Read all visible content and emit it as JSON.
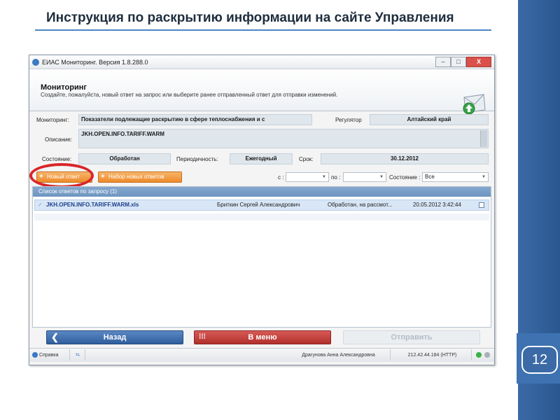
{
  "slide": {
    "title": "Инструкция по раскрытию информации на сайте Управления",
    "page_number": "12"
  },
  "window": {
    "title": "ЕИАС Мониторинг. Версия 1.8.288.0",
    "buttons": {
      "minimize": "–",
      "maximize": "□",
      "close": "X"
    }
  },
  "header": {
    "title": "Мониторинг",
    "subtitle": "Создайте, пожалуйста, новый ответ на запрос или выберите ранее отправленный ответ для отправки изменений."
  },
  "form": {
    "monitoring_label": "Мониторинг:",
    "monitoring_value": "Показатели подлежащие раскрытию в сфере теплоснабжения и с",
    "regulator_label": "Регулятор",
    "regulator_value": "Алтайский край",
    "description_label": "Описание:",
    "description_value": "JKH.OPEN.INFO.TARIFF.WARM",
    "state_label": "Состояние:",
    "state_value": "Обработан",
    "period_label": "Периодичность:",
    "period_value": "Ежегодный",
    "deadline_label": "Срок:",
    "deadline_value": "30.12.2012"
  },
  "toolbar": {
    "new_answer": "Новый ответ",
    "new_answers_set": "Набор новых ответов",
    "from_label": "с :",
    "to_label": "по :",
    "state_filter_label": "Состояние :",
    "state_filter_value": "Все"
  },
  "list": {
    "header": "Список ответов по запросу (1)",
    "rows": [
      {
        "file": "JKH.OPEN.INFO.TARIFF.WARM.xls",
        "user": "Бриткин Сергей Александрович",
        "state": "Обработан, на рассмот...",
        "date": "20.05.2012 3:42:44"
      }
    ]
  },
  "bottom": {
    "back": "Назад",
    "menu": "В меню",
    "send": "Отправить"
  },
  "statusbar": {
    "help": "Справка",
    "user": "Драгунова Анна Александровна",
    "address": "212.42.44.184 (HTTP)"
  },
  "colors": {
    "accent_blue": "#2f5d96",
    "orange": "#ee8a2a",
    "red": "#b1302c",
    "ring_red": "#d8262a"
  }
}
